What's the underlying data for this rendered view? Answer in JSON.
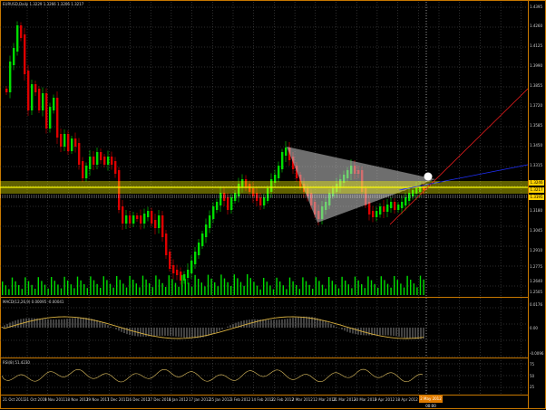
{
  "chart": {
    "main_title": "EURUSD,Daily  1.3229 1.3266 1.3206 1.3217",
    "macd_title": "MACD(12,26,9) 0.00095 -0.00041",
    "rsi_title": "RSI(8) 51.4230",
    "marker_date": "2 May 2012 00:00",
    "price_tags": [
      "1.3246",
      "1.3217",
      "1.3195"
    ],
    "price_axis": [
      "1.4395",
      "1.4260",
      "1.4125",
      "1.3990",
      "1.3855",
      "1.3720",
      "1.3585",
      "1.3450",
      "1.3315",
      "1.3180",
      "1.3045",
      "1.2910",
      "1.2775",
      "1.2640",
      "1.2505"
    ],
    "macd_axis": [
      "0.0176",
      "0.00",
      "-0.0096"
    ],
    "rsi_axis": [
      "75",
      "50",
      "25"
    ],
    "dates": [
      "21 Oct 2011",
      "31 Oct 2011",
      "9 Nov 2011",
      "18 Nov 2011",
      "29 Nov 2011",
      "7 Dec 2011",
      "16 Dec 2011",
      "27 Dec 2011",
      "6 Jan 2012",
      "17 Jan 2012",
      "25 Jan 2012",
      "3 Feb 2012",
      "14 Feb 2012",
      "22 Feb 2012",
      "2 Mar 2012",
      "12 Mar 2012",
      "21 Mar 2012",
      "30 Mar 2012",
      "9 Apr 2012",
      "18 Apr 2012"
    ]
  },
  "colors": {
    "bg": "#000000",
    "up": "#00dd00",
    "down": "#dd0000",
    "grid": "#5a5a5a",
    "hline": "#ffff00",
    "macd_line": "#d8b040",
    "border": "#c87800",
    "triangle": "#c8c8c8",
    "trend_red": "#ff2020",
    "trend_blue": "#2030ff"
  }
}
